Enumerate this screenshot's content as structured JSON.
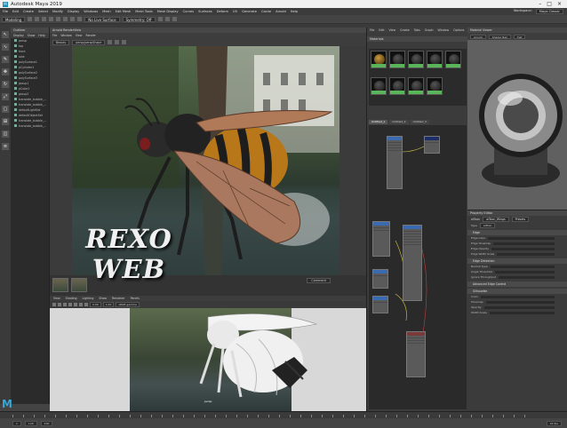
{
  "window": {
    "title": "Autodesk Maya 2019"
  },
  "menubar": {
    "items": [
      "File",
      "Edit",
      "Create",
      "Select",
      "Modify",
      "Display",
      "Windows",
      "Mesh",
      "Edit Mesh",
      "Mesh Tools",
      "Mesh Display",
      "Curves",
      "Surfaces",
      "Deform",
      "UV",
      "Generate",
      "Cache",
      "Arnold",
      "Help"
    ],
    "workspace": "Maya Classic"
  },
  "statusline": {
    "menuset": "Modeling",
    "live": "No Live Surface",
    "symmetry": "Symmetry: Off"
  },
  "outliner": {
    "title": "Outliner",
    "menu": [
      "Display",
      "Show",
      "Help"
    ],
    "items": [
      "persp",
      "top",
      "front",
      "side",
      "polySurface1",
      "pCylinder1",
      "polySurface2",
      "polySurface3",
      "group1",
      "pCube1",
      "group2",
      "translate_bubble_...",
      "translate_bubble_...",
      "defaultLightSet",
      "defaultObjectSet",
      "translate_bubble_...",
      "translate_bubble_..."
    ]
  },
  "renderview": {
    "title": "Arnold RenderView",
    "menu": [
      "File",
      "Window",
      "View",
      "Render"
    ],
    "camera": "Beauty",
    "resolution": "persp/perspShape",
    "compare": "Comment"
  },
  "viewport": {
    "menu": [
      "View",
      "Shading",
      "Lighting",
      "Show",
      "Renderer",
      "Panels"
    ],
    "camera_label": "persp",
    "gamma": "sRGB gamma",
    "values": [
      "0.00",
      "1.00"
    ]
  },
  "hypershade": {
    "menu": [
      "File",
      "Edit",
      "View",
      "Create",
      "Tabs",
      "Graph",
      "Window",
      "Options",
      "Help"
    ],
    "tabs": [
      "Untitled_1",
      "Untitled_2",
      "Untitled_3"
    ],
    "swatch_tab": "Materials"
  },
  "material_viewer": {
    "title": "Material Viewer",
    "renderer": "Arnold",
    "shape": "Shader Ball",
    "env": "Flat"
  },
  "attribute_editor": {
    "title": "Property Editor",
    "node_label": "aiToon",
    "node_name": "aiToon_Wings",
    "presets": "Presets",
    "type_label": "Type",
    "type_value": "aiToon",
    "sections": [
      "Edge",
      "Edge Detection",
      "Advanced Edge Control",
      "Silhouette"
    ],
    "rows": [
      "Edge Color",
      "Edge Tonemap",
      "Edge Opacity",
      "Edge Width Scale",
      "Normal Type",
      "Angle Threshold",
      "Ignore Throughput",
      "Color",
      "Tonemap",
      "Opacity",
      "Width Scale"
    ]
  },
  "timeline": {
    "start": "1",
    "end": "120",
    "playback_end": "200",
    "fps": "24 fps"
  },
  "watermark": "REXO WEB",
  "colors": {
    "maya_blue": "#38a6d6",
    "node_blue": "#3a6ab0",
    "swatch_green": "#5ab55a"
  }
}
